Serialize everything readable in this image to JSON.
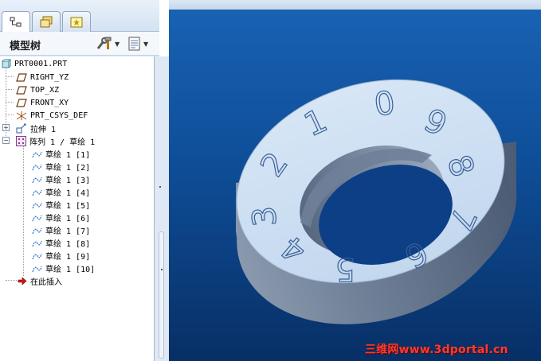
{
  "tabs": [
    {
      "name": "model-tree",
      "icon": "model-tree-icon"
    },
    {
      "name": "folders",
      "icon": "folder-browser-icon"
    },
    {
      "name": "favorites",
      "icon": "favorites-icon"
    }
  ],
  "tree_header": {
    "title": "模型树"
  },
  "tree": {
    "root": "PRT0001.PRT",
    "datums": [
      {
        "label": "RIGHT_YZ",
        "icon": "datum-plane-icon"
      },
      {
        "label": "TOP_XZ",
        "icon": "datum-plane-icon"
      },
      {
        "label": "FRONT_XY",
        "icon": "datum-plane-icon"
      },
      {
        "label": "PRT_CSYS_DEF",
        "icon": "coordinate-system-icon"
      }
    ],
    "extrude": "拉伸 1",
    "pattern": "阵列 1 / 草绘 1",
    "pattern_members": [
      "草绘 1 [1]",
      "草绘 1 [2]",
      "草绘 1 [3]",
      "草绘 1 [4]",
      "草绘 1 [5]",
      "草绘 1 [6]",
      "草绘 1 [7]",
      "草绘 1 [8]",
      "草绘 1 [9]",
      "草绘 1 [10]"
    ],
    "insert_here": "在此插入"
  },
  "model": {
    "ring_digits": [
      "0",
      "9",
      "8",
      "7",
      "6",
      "5",
      "4",
      "3",
      "2",
      "1"
    ],
    "colors": {
      "top_face": "#c8dcf1",
      "side_face": "#6e7f96",
      "background_top": "#1a63b5",
      "background_bottom": "#082f66"
    }
  },
  "watermark": "三维网www.3dportal.cn"
}
